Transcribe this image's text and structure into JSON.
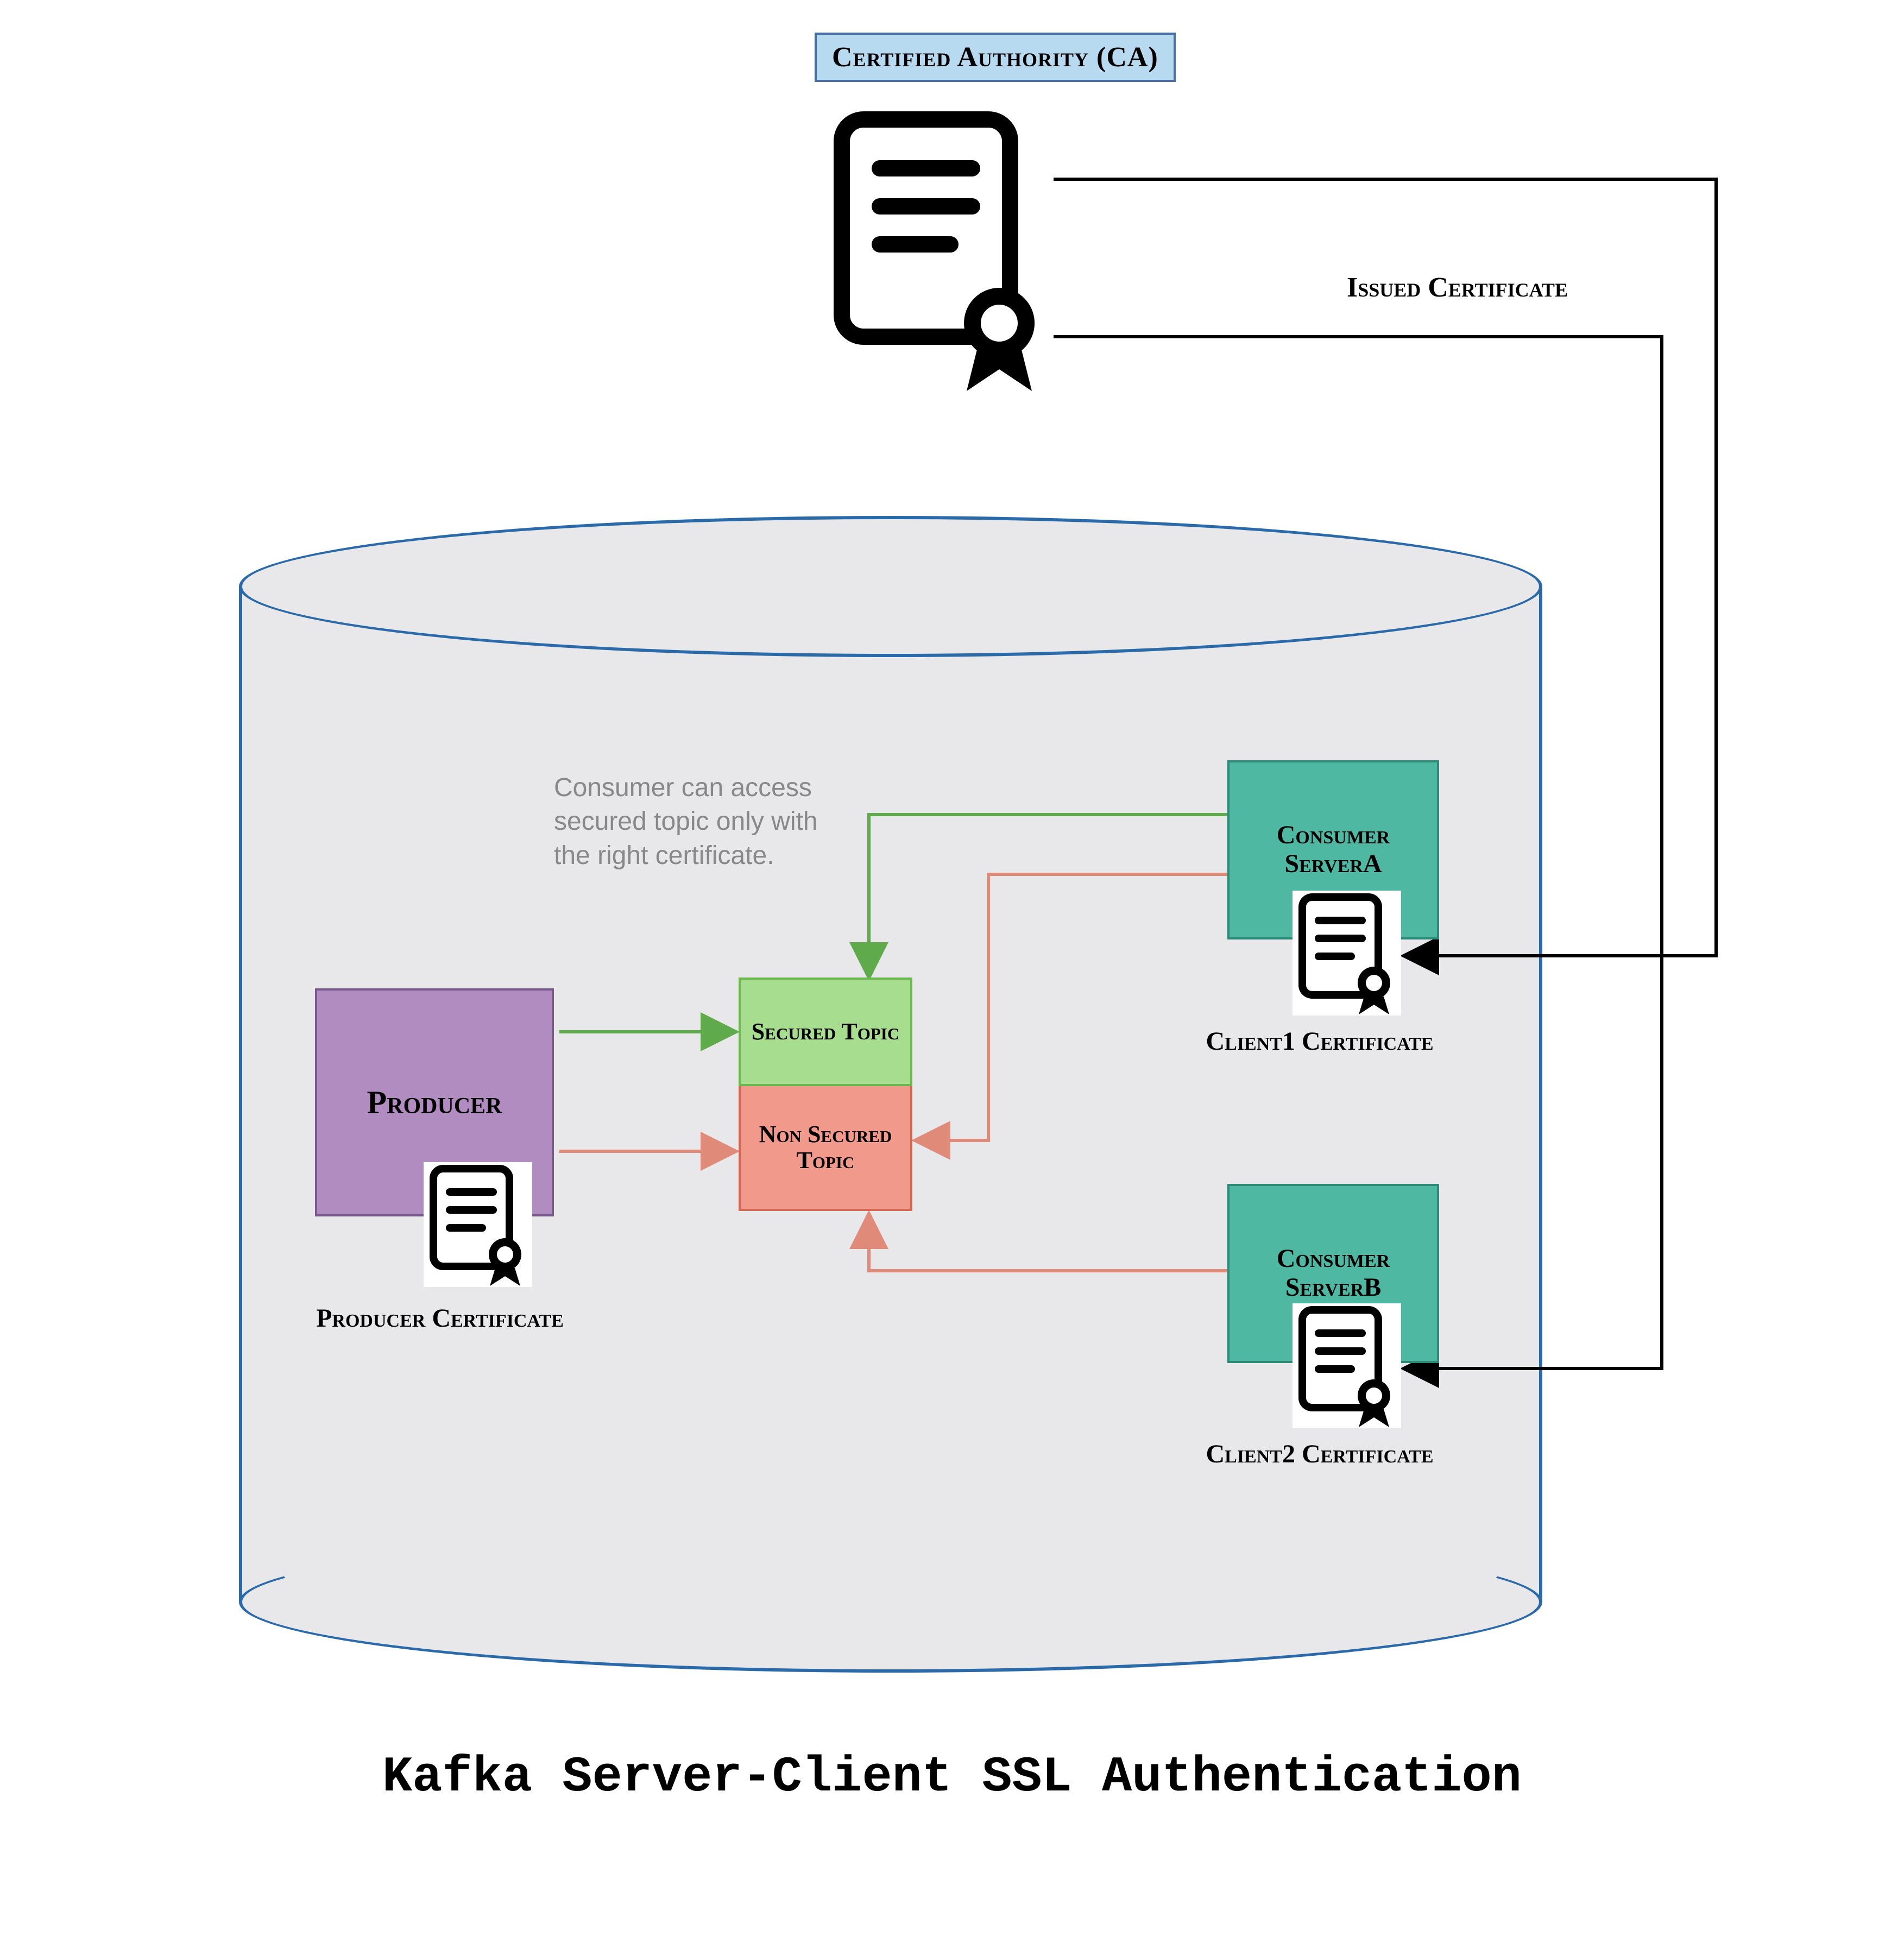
{
  "header": {
    "ca_label": "Certified Authority (CA)",
    "issued_label": "Issued Certificate"
  },
  "cylinder": {
    "note": "Consumer can access secured topic only with the right certificate.",
    "producer": {
      "label": "Producer",
      "cert_caption": "Producer Certificate"
    },
    "topics": {
      "secured": "Secured Topic",
      "nonsecured": "Non Secured Topic"
    },
    "consumers": {
      "a": {
        "label": "Consumer ServerA",
        "cert_caption": "Client1 Certificate"
      },
      "b": {
        "label": "Consumer ServerB",
        "cert_caption": "Client2 Certificate"
      }
    }
  },
  "title": "Kafka Server-Client SSL Authentication",
  "colors": {
    "ca_bg": "#b8daf0",
    "ca_border": "#4a6fa5",
    "cyl_fill": "#e8e7e9",
    "cyl_stroke": "#2b6aa8",
    "producer_bg": "#b18cc0",
    "producer_border": "#7a5a8c",
    "secured_bg": "#a6dd8f",
    "secured_border": "#6bb84e",
    "nonsecured_bg": "#f19a8b",
    "nonsecured_border": "#d26a56",
    "consumer_bg": "#4fb8a3",
    "consumer_border": "#2d8a76",
    "arrow_green": "#5faa4a",
    "arrow_red": "#e08a7a",
    "arrow_black": "#000000"
  }
}
